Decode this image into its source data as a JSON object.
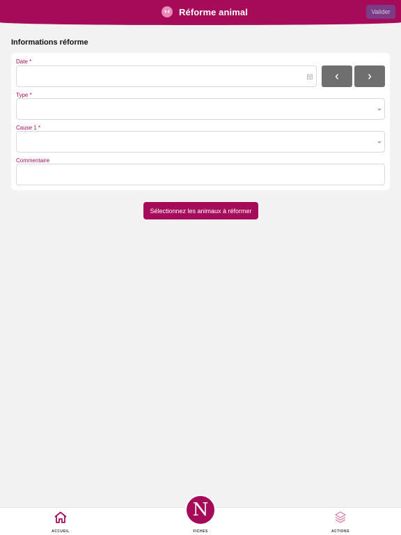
{
  "header": {
    "title": "Réforme animal",
    "valider_label": "Valider"
  },
  "section": {
    "title": "Informations réforme"
  },
  "form": {
    "date": {
      "label": "Date *",
      "value": ""
    },
    "type": {
      "label": "Type *",
      "value": ""
    },
    "cause1": {
      "label": "Cause 1 *",
      "value": ""
    },
    "commentaire": {
      "label": "Commentaire",
      "value": ""
    }
  },
  "main_action": {
    "label": "Sélectionnez les animaux à réformer"
  },
  "bottom_nav": {
    "items": [
      {
        "label": "ACCUEIL",
        "icon": "home-icon"
      },
      {
        "label": "FICHES",
        "icon": "logo-n-icon",
        "logo_letter": "N"
      },
      {
        "label": "ACTIONS",
        "icon": "layers-icon"
      }
    ]
  },
  "colors": {
    "primary": "#a60b5a",
    "header_button": "#7a3d85",
    "nav_button": "#6f6f6f",
    "background": "#f2f2f2",
    "actions_icon": "#d58ab4"
  }
}
